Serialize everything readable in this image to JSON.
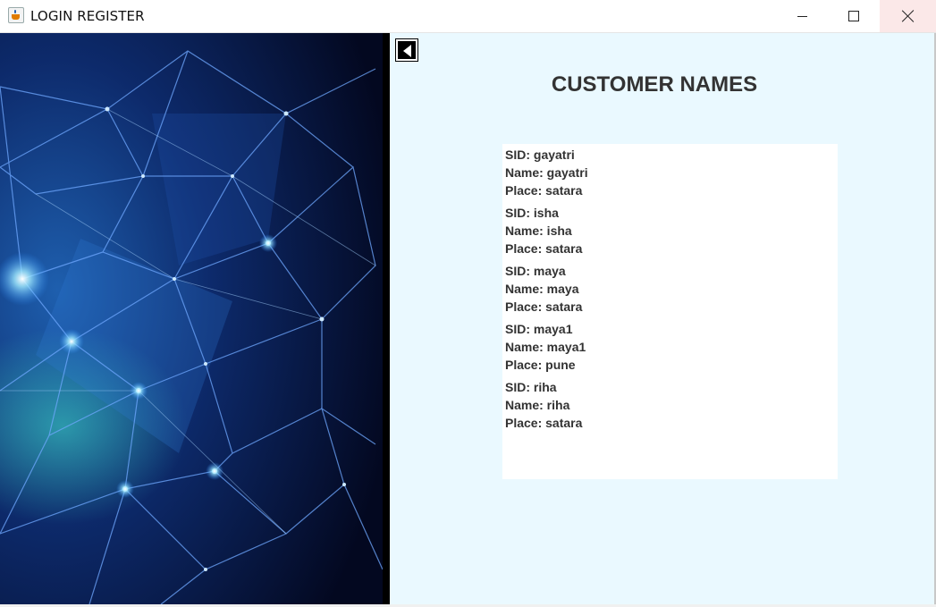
{
  "window": {
    "title": "LOGIN REGISTER",
    "icon": "java-cup-icon",
    "controls": [
      "minimize-icon",
      "maximize-icon",
      "close-icon"
    ]
  },
  "left_panel": {
    "image": "blue-network-mesh-background"
  },
  "right_panel": {
    "back_button_icon": "back-arrow-icon",
    "title": "CUSTOMER NAMES",
    "customers": [
      {
        "sid": "SID: gayatri",
        "name": "Name: gayatri",
        "place": "Place: satara"
      },
      {
        "sid": "SID: isha",
        "name": "Name: isha",
        "place": "Place: satara"
      },
      {
        "sid": "SID: maya",
        "name": "Name: maya",
        "place": "Place: satara"
      },
      {
        "sid": "SID: maya1",
        "name": "Name: maya1",
        "place": "Place: pune"
      },
      {
        "sid": "SID: riha",
        "name": "Name: riha",
        "place": "Place: satara"
      }
    ]
  },
  "colors": {
    "right_panel_bg": "#eaf9ff",
    "list_bg": "#ffffff",
    "text": "#333333",
    "close_hover": "#fbe8e8"
  }
}
